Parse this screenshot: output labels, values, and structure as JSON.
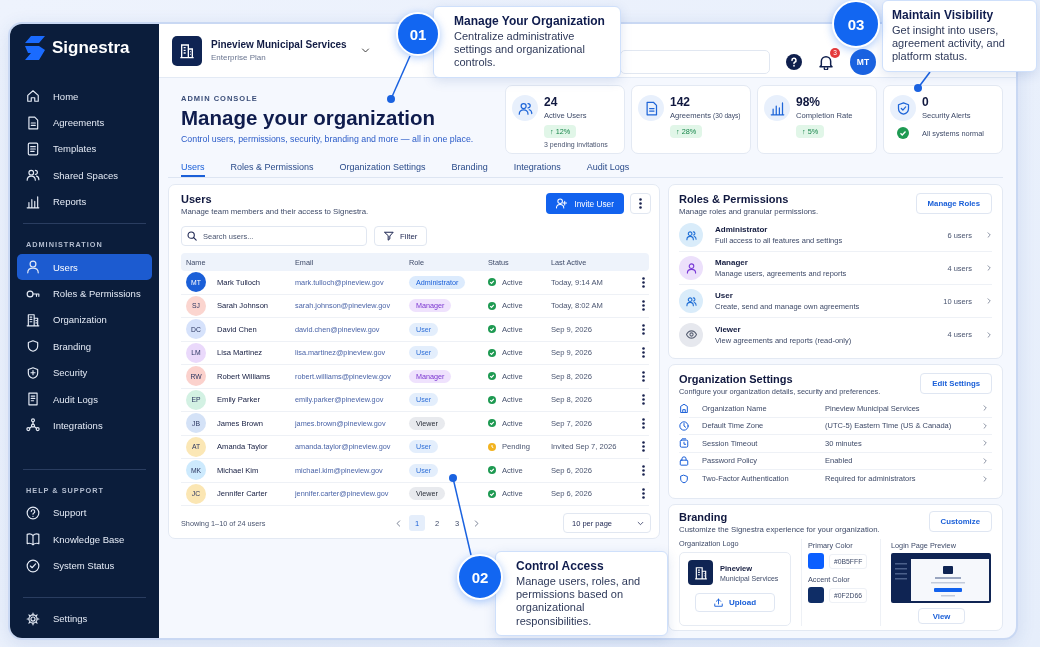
{
  "brand": {
    "name": "Signestra"
  },
  "sidebar": {
    "main_items": [
      {
        "label": "Home",
        "selected": false
      },
      {
        "label": "Agreements",
        "selected": false
      },
      {
        "label": "Templates",
        "selected": false
      },
      {
        "label": "Shared Spaces",
        "selected": false
      },
      {
        "label": "Reports",
        "selected": false
      }
    ],
    "sections": [
      {
        "heading": "ADMINISTRATION",
        "items": [
          {
            "label": "Users",
            "selected": true
          },
          {
            "label": "Roles & Permissions",
            "selected": false
          },
          {
            "label": "Organization",
            "selected": false
          },
          {
            "label": "Branding",
            "selected": false
          },
          {
            "label": "Security",
            "selected": false
          },
          {
            "label": "Audit Logs",
            "selected": false
          },
          {
            "label": "Integrations",
            "selected": false
          }
        ]
      },
      {
        "heading": "HELP & SUPPORT",
        "items": [
          {
            "label": "Support",
            "selected": false
          },
          {
            "label": "Knowledge Base",
            "selected": false
          },
          {
            "label": "System Status",
            "selected": false
          }
        ]
      }
    ],
    "footer_items": [
      {
        "label": "Settings",
        "selected": false
      }
    ]
  },
  "header": {
    "org_name": "Pineview Municipal Services",
    "plan": "Enterprise Plan",
    "notification_count": "3",
    "avatar_initials": "MT"
  },
  "hero": {
    "eyebrow": "ADMIN CONSOLE",
    "title": "Manage your organization",
    "subtitle": "Control users, permissions, security, branding and more — all in one place."
  },
  "stats": [
    {
      "value": "24",
      "label": "Active Users",
      "change": "↑ 12%",
      "note": "3 pending invitations"
    },
    {
      "value": "142",
      "label": "Agreements",
      "qualifier": "(30 days)",
      "change": "↑ 28%"
    },
    {
      "value": "98%",
      "label": "Completion Rate",
      "change": "↑ 5%"
    },
    {
      "value": "0",
      "label": "Security Alerts",
      "status": "All systems normal"
    }
  ],
  "tabs": [
    {
      "label": "Users",
      "selected": true
    },
    {
      "label": "Roles & Permissions",
      "selected": false
    },
    {
      "label": "Organization Settings",
      "selected": false
    },
    {
      "label": "Branding",
      "selected": false
    },
    {
      "label": "Integrations",
      "selected": false
    },
    {
      "label": "Audit Logs",
      "selected": false
    }
  ],
  "users": {
    "title": "Users",
    "subtitle": "Manage team members and their access to Signestra.",
    "invite_label": "Invite User",
    "search_placeholder": "Search users...",
    "filter_label": "Filter",
    "columns": [
      "Name",
      "Email",
      "Role",
      "Status",
      "Last Active"
    ],
    "rows": [
      {
        "initials": "MT",
        "color": "#1a5fd8",
        "name": "Mark Tulloch",
        "email": "mark.tulloch@pineview.gov",
        "role": {
          "label": "Administrator",
          "kind": "admin"
        },
        "status": {
          "label": "Active",
          "kind": "active"
        },
        "last_active": "Today, 9:14 AM"
      },
      {
        "initials": "SJ",
        "color": "#fbd5cf",
        "name": "Sarah Johnson",
        "email": "sarah.johnson@pineview.gov",
        "role": {
          "label": "Manager",
          "kind": "manager"
        },
        "status": {
          "label": "Active",
          "kind": "active"
        },
        "last_active": "Today, 8:02 AM"
      },
      {
        "initials": "DC",
        "color": "#d6e2fb",
        "name": "David Chen",
        "email": "david.chen@pineview.gov",
        "role": {
          "label": "User",
          "kind": "user"
        },
        "status": {
          "label": "Active",
          "kind": "active"
        },
        "last_active": "Sep 9, 2026"
      },
      {
        "initials": "LM",
        "color": "#ead9fb",
        "name": "Lisa Martinez",
        "email": "lisa.martinez@pineview.gov",
        "role": {
          "label": "User",
          "kind": "user"
        },
        "status": {
          "label": "Active",
          "kind": "active"
        },
        "last_active": "Sep 9, 2026"
      },
      {
        "initials": "RW",
        "color": "#fbd1cc",
        "name": "Robert Williams",
        "email": "robert.williams@pineview.gov",
        "role": {
          "label": "Manager",
          "kind": "manager"
        },
        "status": {
          "label": "Active",
          "kind": "active"
        },
        "last_active": "Sep 8, 2026"
      },
      {
        "initials": "EP",
        "color": "#d3f1e3",
        "name": "Emily Parker",
        "email": "emily.parker@pineview.gov",
        "role": {
          "label": "User",
          "kind": "user"
        },
        "status": {
          "label": "Active",
          "kind": "active"
        },
        "last_active": "Sep 8, 2026"
      },
      {
        "initials": "JB",
        "color": "#d4e2f7",
        "name": "James Brown",
        "email": "james.brown@pineview.gov",
        "role": {
          "label": "Viewer",
          "kind": "viewer"
        },
        "status": {
          "label": "Active",
          "kind": "active"
        },
        "last_active": "Sep 7, 2026"
      },
      {
        "initials": "AT",
        "color": "#fbe7b5",
        "name": "Amanda Taylor",
        "email": "amanda.taylor@pineview.gov",
        "role": {
          "label": "User",
          "kind": "user"
        },
        "status": {
          "label": "Pending",
          "kind": "pending"
        },
        "last_active": "Invited Sep 7, 2026"
      },
      {
        "initials": "MK",
        "color": "#cdeafd",
        "name": "Michael Kim",
        "email": "michael.kim@pineview.gov",
        "role": {
          "label": "User",
          "kind": "user"
        },
        "status": {
          "label": "Active",
          "kind": "active"
        },
        "last_active": "Sep 6, 2026"
      },
      {
        "initials": "JC",
        "color": "#fbe6b3",
        "name": "Jennifer Carter",
        "email": "jennifer.carter@pineview.gov",
        "role": {
          "label": "Viewer",
          "kind": "viewer"
        },
        "status": {
          "label": "Active",
          "kind": "active"
        },
        "last_active": "Sep 6, 2026"
      }
    ],
    "summary": "Showing 1–10 of 24 users",
    "pages": [
      {
        "label": "1",
        "selected": true
      },
      {
        "label": "2",
        "selected": false
      },
      {
        "label": "3",
        "selected": false
      }
    ],
    "per_page": "10 per page"
  },
  "roles": {
    "title": "Roles & Permissions",
    "subtitle": "Manage roles and granular permissions.",
    "action": "Manage Roles",
    "items": [
      {
        "name": "Administrator",
        "description": "Full access to all features and settings",
        "count": "6 users",
        "color": "#d9ecfa"
      },
      {
        "name": "Manager",
        "description": "Manage users, agreements and reports",
        "count": "4 users",
        "color": "#ece0fb"
      },
      {
        "name": "User",
        "description": "Create, send and manage own agreements",
        "count": "10 users",
        "color": "#d9ecfa"
      },
      {
        "name": "Viewer",
        "description": "View agreements and reports (read-only)",
        "count": "4 users",
        "color": "#e6e8ee"
      }
    ]
  },
  "org_settings": {
    "title": "Organization Settings",
    "subtitle": "Configure your organization details, security and preferences.",
    "action": "Edit Settings",
    "rows": [
      {
        "label": "Organization Name",
        "value": "Pineview Municipal Services"
      },
      {
        "label": "Default Time Zone",
        "value": "(UTC-5) Eastern Time (US & Canada)"
      },
      {
        "label": "Session Timeout",
        "value": "30 minutes"
      },
      {
        "label": "Password Policy",
        "value": "Enabled"
      },
      {
        "label": "Two-Factor Authentication",
        "value": "Required for administrators"
      }
    ]
  },
  "branding": {
    "title": "Branding",
    "subtitle": "Customize the Signestra experience for your organization.",
    "action": "Customize",
    "logo_label": "Organization Logo",
    "logo_name": "Pineview",
    "logo_subname": "Municipal Services",
    "upload_label": "Upload",
    "colors": [
      {
        "label": "Primary Color",
        "hex": "#0B5FFF",
        "color": "#0b5fff"
      },
      {
        "label": "Accent Color",
        "hex": "#0F2D66",
        "color": "#0f2d66"
      }
    ],
    "preview_label": "Login Page Preview",
    "view_label": "View"
  },
  "callouts": [
    {
      "number": "01",
      "title": "Manage Your Organization",
      "text": "Centralize administrative settings and organizational controls."
    },
    {
      "number": "02",
      "title": "Control Access",
      "text": "Manage users, roles, and permissions based on organizational responsibilities."
    },
    {
      "number": "03",
      "title": "Maintain Visibility",
      "text": "Get insight into users, agreement activity, and platform status."
    }
  ]
}
